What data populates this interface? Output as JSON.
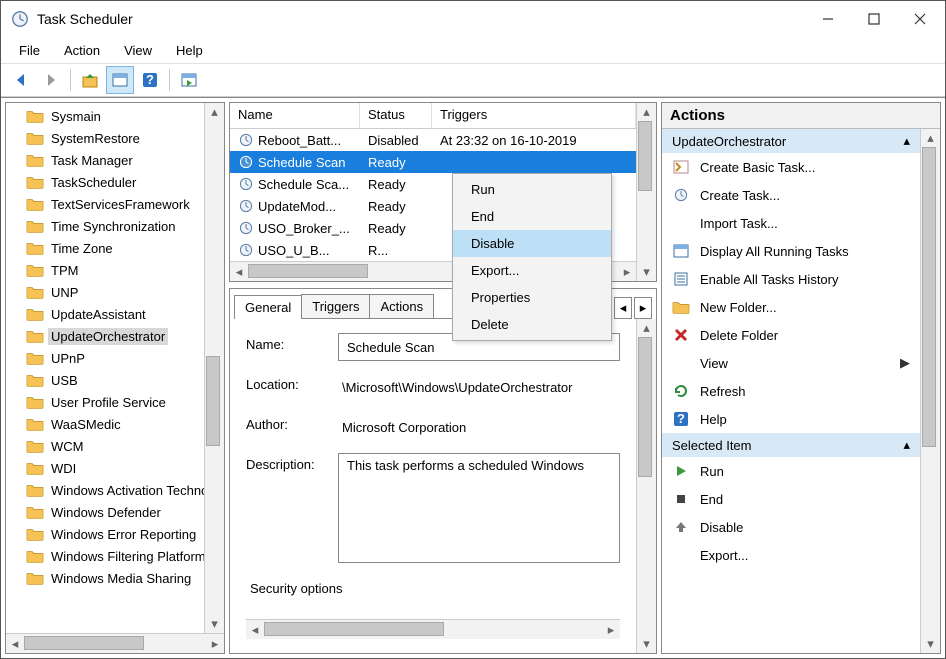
{
  "window": {
    "title": "Task Scheduler"
  },
  "menu": {
    "file": "File",
    "action": "Action",
    "view": "View",
    "help": "Help"
  },
  "tree": {
    "items": [
      {
        "label": "Sysmain"
      },
      {
        "label": "SystemRestore"
      },
      {
        "label": "Task Manager"
      },
      {
        "label": "TaskScheduler"
      },
      {
        "label": "TextServicesFramework"
      },
      {
        "label": "Time Synchronization"
      },
      {
        "label": "Time Zone"
      },
      {
        "label": "TPM"
      },
      {
        "label": "UNP"
      },
      {
        "label": "UpdateAssistant"
      },
      {
        "label": "UpdateOrchestrator",
        "selected": true
      },
      {
        "label": "UPnP"
      },
      {
        "label": "USB"
      },
      {
        "label": "User Profile Service"
      },
      {
        "label": "WaaSMedic"
      },
      {
        "label": "WCM"
      },
      {
        "label": "WDI"
      },
      {
        "label": "Windows Activation Technologies"
      },
      {
        "label": "Windows Defender"
      },
      {
        "label": "Windows Error Reporting"
      },
      {
        "label": "Windows Filtering Platform"
      },
      {
        "label": "Windows Media Sharing"
      }
    ]
  },
  "list": {
    "cols": {
      "name": "Name",
      "status": "Status",
      "triggers": "Triggers"
    },
    "rows": [
      {
        "name": "Reboot_Batt...",
        "status": "Disabled",
        "triggers": "At 23:32 on 16-10-2019"
      },
      {
        "name": "Schedule Scan",
        "status": "Ready",
        "triggers": "",
        "selected": true
      },
      {
        "name": "Schedule Sca...",
        "status": "Ready",
        "triggers": ""
      },
      {
        "name": "UpdateMod...",
        "status": "Ready",
        "triggers": ""
      },
      {
        "name": "USO_Broker_...",
        "status": "Ready",
        "triggers": ""
      },
      {
        "name": "USO_U_B...",
        "status": "R...",
        "triggers": ""
      }
    ]
  },
  "tabs": {
    "general": "General",
    "triggers": "Triggers",
    "actions": "Actions"
  },
  "detail": {
    "name_label": "Name:",
    "name_value": "Schedule Scan",
    "location_label": "Location:",
    "location_value": "\\Microsoft\\Windows\\UpdateOrchestrator",
    "author_label": "Author:",
    "author_value": "Microsoft Corporation",
    "desc_label": "Description:",
    "desc_value": "This task performs a scheduled Windows",
    "security": "Security options"
  },
  "context": {
    "run": "Run",
    "end": "End",
    "disable": "Disable",
    "export": "Export...",
    "properties": "Properties",
    "delete": "Delete"
  },
  "actions": {
    "header": "Actions",
    "group1": "UpdateOrchestrator",
    "items1": [
      {
        "icon": "wizard",
        "label": "Create Basic Task..."
      },
      {
        "icon": "clock",
        "label": "Create Task..."
      },
      {
        "icon": "blank",
        "label": "Import Task..."
      },
      {
        "icon": "running",
        "label": "Display All Running Tasks"
      },
      {
        "icon": "history",
        "label": "Enable All Tasks History"
      },
      {
        "icon": "newfolder",
        "label": "New Folder..."
      },
      {
        "icon": "delete",
        "label": "Delete Folder"
      },
      {
        "icon": "blank",
        "label": "View",
        "arrow": true
      },
      {
        "icon": "refresh",
        "label": "Refresh"
      },
      {
        "icon": "help",
        "label": "Help"
      }
    ],
    "group2": "Selected Item",
    "items2": [
      {
        "icon": "run",
        "label": "Run"
      },
      {
        "icon": "end",
        "label": "End"
      },
      {
        "icon": "disable",
        "label": "Disable"
      },
      {
        "icon": "blank",
        "label": "Export..."
      }
    ]
  }
}
